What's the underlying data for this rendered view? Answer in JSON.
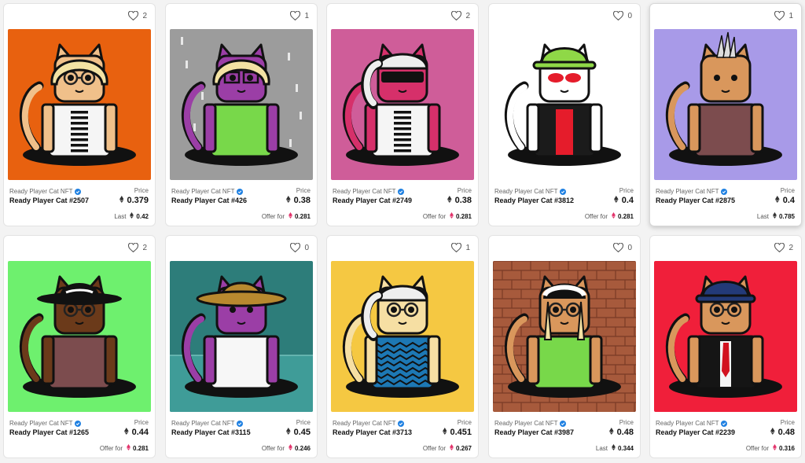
{
  "collection_name": "Ready Player Cat NFT",
  "price_label": "Price",
  "cards": [
    {
      "likes": "2",
      "name": "Ready Player Cat #2507",
      "price": "0.379",
      "foot_label": "Last",
      "foot_value": "0.42",
      "foot_kind": "last",
      "bg": "#e8610f",
      "fur": "#f0c08a",
      "hat": "bob-blonde",
      "shirt": "coat-stripes",
      "glasses": "round",
      "raised": false
    },
    {
      "likes": "1",
      "name": "Ready Player Cat #426",
      "price": "0.38",
      "foot_label": "Offer for",
      "foot_value": "0.281",
      "foot_kind": "offer",
      "bg": "#9c9c9c",
      "fur": "#9b3ea6",
      "hat": "bob-blonde",
      "shirt": "green-top",
      "glasses": "square",
      "raised": false
    },
    {
      "likes": "2",
      "name": "Ready Player Cat #2749",
      "price": "0.38",
      "foot_label": "Offer for",
      "foot_value": "0.281",
      "foot_kind": "offer",
      "bg": "#cf5d99",
      "fur": "#d6306a",
      "hat": "ponytail-white",
      "shirt": "coat-stripes",
      "glasses": "visor",
      "raised": false
    },
    {
      "likes": "0",
      "name": "Ready Player Cat #3812",
      "price": "0.4",
      "foot_label": "Offer for",
      "foot_value": "0.281",
      "foot_kind": "offer",
      "bg": "#ffffff",
      "fur": "#ffffff",
      "hat": "bucket-green",
      "shirt": "leather-red",
      "glasses": "red",
      "raised": false
    },
    {
      "likes": "1",
      "name": "Ready Player Cat #2875",
      "price": "0.4",
      "foot_label": "Last",
      "foot_value": "0.785",
      "foot_kind": "last",
      "bg": "#a89ae8",
      "fur": "#d9975c",
      "hat": "spikes",
      "shirt": "maroon-top",
      "glasses": "none",
      "raised": true
    },
    {
      "likes": "2",
      "name": "Ready Player Cat #1265",
      "price": "0.44",
      "foot_label": "Offer for",
      "foot_value": "0.281",
      "foot_kind": "offer",
      "bg": "#6ef06e",
      "fur": "#6b3a1a",
      "hat": "fedora-black",
      "shirt": "maroon-top",
      "glasses": "round",
      "raised": false
    },
    {
      "likes": "0",
      "name": "Ready Player Cat #3115",
      "price": "0.45",
      "foot_label": "Offer for",
      "foot_value": "0.246",
      "foot_kind": "offer",
      "bg": "#2d7d7a",
      "fur": "#9b3ea6",
      "hat": "cowboy-tan",
      "shirt": "white-top",
      "glasses": "none",
      "raised": false
    },
    {
      "likes": "1",
      "name": "Ready Player Cat #3713",
      "price": "0.451",
      "foot_label": "Offer for",
      "foot_value": "0.267",
      "foot_kind": "offer",
      "bg": "#f5c842",
      "fur": "#f6dfa3",
      "hat": "ponytail-white",
      "shirt": "zigzag",
      "glasses": "round",
      "raised": false
    },
    {
      "likes": "0",
      "name": "Ready Player Cat #3987",
      "price": "0.48",
      "foot_label": "Last",
      "foot_value": "0.344",
      "foot_kind": "last",
      "bg": "#a75a3c",
      "fur": "#d9975c",
      "hat": "cap-white",
      "shirt": "green-top",
      "glasses": "round",
      "raised": false
    },
    {
      "likes": "2",
      "name": "Ready Player Cat #2239",
      "price": "0.48",
      "foot_label": "Offer for",
      "foot_value": "0.316",
      "foot_kind": "offer",
      "bg": "#f01f3a",
      "fur": "#d9975c",
      "hat": "bucket-navy",
      "shirt": "suit-red",
      "glasses": "round",
      "raised": false
    }
  ],
  "colors": {
    "verified": "#2081e2",
    "offer_eth": "#e2336b",
    "eth_dark": "#333333"
  }
}
